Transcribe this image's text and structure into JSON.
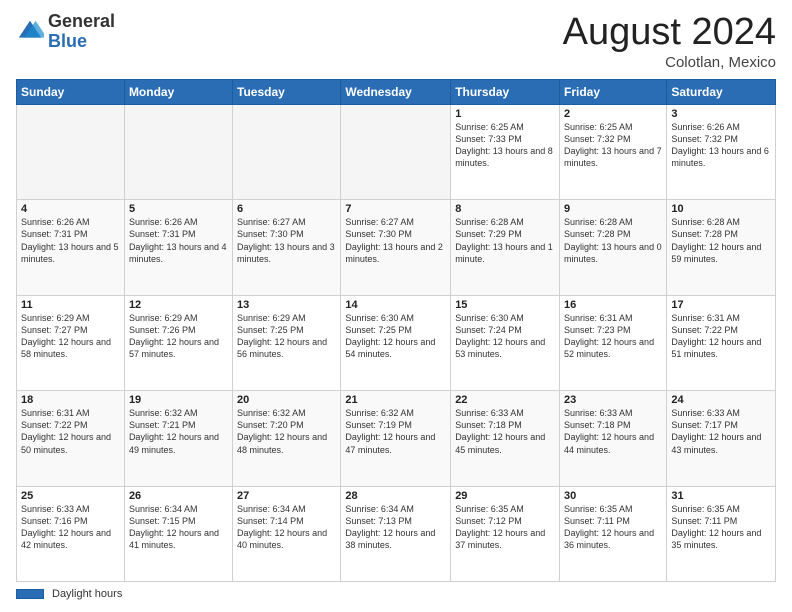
{
  "header": {
    "logo_general": "General",
    "logo_blue": "Blue",
    "month_title": "August 2024",
    "location": "Colotlan, Mexico"
  },
  "calendar": {
    "days_of_week": [
      "Sunday",
      "Monday",
      "Tuesday",
      "Wednesday",
      "Thursday",
      "Friday",
      "Saturday"
    ],
    "weeks": [
      [
        {
          "day": "",
          "info": "",
          "empty": true
        },
        {
          "day": "",
          "info": "",
          "empty": true
        },
        {
          "day": "",
          "info": "",
          "empty": true
        },
        {
          "day": "",
          "info": "",
          "empty": true
        },
        {
          "day": "1",
          "info": "Sunrise: 6:25 AM\nSunset: 7:33 PM\nDaylight: 13 hours\nand 8 minutes.",
          "empty": false
        },
        {
          "day": "2",
          "info": "Sunrise: 6:25 AM\nSunset: 7:32 PM\nDaylight: 13 hours\nand 7 minutes.",
          "empty": false
        },
        {
          "day": "3",
          "info": "Sunrise: 6:26 AM\nSunset: 7:32 PM\nDaylight: 13 hours\nand 6 minutes.",
          "empty": false
        }
      ],
      [
        {
          "day": "4",
          "info": "Sunrise: 6:26 AM\nSunset: 7:31 PM\nDaylight: 13 hours\nand 5 minutes.",
          "empty": false
        },
        {
          "day": "5",
          "info": "Sunrise: 6:26 AM\nSunset: 7:31 PM\nDaylight: 13 hours\nand 4 minutes.",
          "empty": false
        },
        {
          "day": "6",
          "info": "Sunrise: 6:27 AM\nSunset: 7:30 PM\nDaylight: 13 hours\nand 3 minutes.",
          "empty": false
        },
        {
          "day": "7",
          "info": "Sunrise: 6:27 AM\nSunset: 7:30 PM\nDaylight: 13 hours\nand 2 minutes.",
          "empty": false
        },
        {
          "day": "8",
          "info": "Sunrise: 6:28 AM\nSunset: 7:29 PM\nDaylight: 13 hours\nand 1 minute.",
          "empty": false
        },
        {
          "day": "9",
          "info": "Sunrise: 6:28 AM\nSunset: 7:28 PM\nDaylight: 13 hours\nand 0 minutes.",
          "empty": false
        },
        {
          "day": "10",
          "info": "Sunrise: 6:28 AM\nSunset: 7:28 PM\nDaylight: 12 hours\nand 59 minutes.",
          "empty": false
        }
      ],
      [
        {
          "day": "11",
          "info": "Sunrise: 6:29 AM\nSunset: 7:27 PM\nDaylight: 12 hours\nand 58 minutes.",
          "empty": false
        },
        {
          "day": "12",
          "info": "Sunrise: 6:29 AM\nSunset: 7:26 PM\nDaylight: 12 hours\nand 57 minutes.",
          "empty": false
        },
        {
          "day": "13",
          "info": "Sunrise: 6:29 AM\nSunset: 7:25 PM\nDaylight: 12 hours\nand 56 minutes.",
          "empty": false
        },
        {
          "day": "14",
          "info": "Sunrise: 6:30 AM\nSunset: 7:25 PM\nDaylight: 12 hours\nand 54 minutes.",
          "empty": false
        },
        {
          "day": "15",
          "info": "Sunrise: 6:30 AM\nSunset: 7:24 PM\nDaylight: 12 hours\nand 53 minutes.",
          "empty": false
        },
        {
          "day": "16",
          "info": "Sunrise: 6:31 AM\nSunset: 7:23 PM\nDaylight: 12 hours\nand 52 minutes.",
          "empty": false
        },
        {
          "day": "17",
          "info": "Sunrise: 6:31 AM\nSunset: 7:22 PM\nDaylight: 12 hours\nand 51 minutes.",
          "empty": false
        }
      ],
      [
        {
          "day": "18",
          "info": "Sunrise: 6:31 AM\nSunset: 7:22 PM\nDaylight: 12 hours\nand 50 minutes.",
          "empty": false
        },
        {
          "day": "19",
          "info": "Sunrise: 6:32 AM\nSunset: 7:21 PM\nDaylight: 12 hours\nand 49 minutes.",
          "empty": false
        },
        {
          "day": "20",
          "info": "Sunrise: 6:32 AM\nSunset: 7:20 PM\nDaylight: 12 hours\nand 48 minutes.",
          "empty": false
        },
        {
          "day": "21",
          "info": "Sunrise: 6:32 AM\nSunset: 7:19 PM\nDaylight: 12 hours\nand 47 minutes.",
          "empty": false
        },
        {
          "day": "22",
          "info": "Sunrise: 6:33 AM\nSunset: 7:18 PM\nDaylight: 12 hours\nand 45 minutes.",
          "empty": false
        },
        {
          "day": "23",
          "info": "Sunrise: 6:33 AM\nSunset: 7:18 PM\nDaylight: 12 hours\nand 44 minutes.",
          "empty": false
        },
        {
          "day": "24",
          "info": "Sunrise: 6:33 AM\nSunset: 7:17 PM\nDaylight: 12 hours\nand 43 minutes.",
          "empty": false
        }
      ],
      [
        {
          "day": "25",
          "info": "Sunrise: 6:33 AM\nSunset: 7:16 PM\nDaylight: 12 hours\nand 42 minutes.",
          "empty": false
        },
        {
          "day": "26",
          "info": "Sunrise: 6:34 AM\nSunset: 7:15 PM\nDaylight: 12 hours\nand 41 minutes.",
          "empty": false
        },
        {
          "day": "27",
          "info": "Sunrise: 6:34 AM\nSunset: 7:14 PM\nDaylight: 12 hours\nand 40 minutes.",
          "empty": false
        },
        {
          "day": "28",
          "info": "Sunrise: 6:34 AM\nSunset: 7:13 PM\nDaylight: 12 hours\nand 38 minutes.",
          "empty": false
        },
        {
          "day": "29",
          "info": "Sunrise: 6:35 AM\nSunset: 7:12 PM\nDaylight: 12 hours\nand 37 minutes.",
          "empty": false
        },
        {
          "day": "30",
          "info": "Sunrise: 6:35 AM\nSunset: 7:11 PM\nDaylight: 12 hours\nand 36 minutes.",
          "empty": false
        },
        {
          "day": "31",
          "info": "Sunrise: 6:35 AM\nSunset: 7:11 PM\nDaylight: 12 hours\nand 35 minutes.",
          "empty": false
        }
      ]
    ]
  },
  "footer": {
    "legend_label": "Daylight hours"
  }
}
